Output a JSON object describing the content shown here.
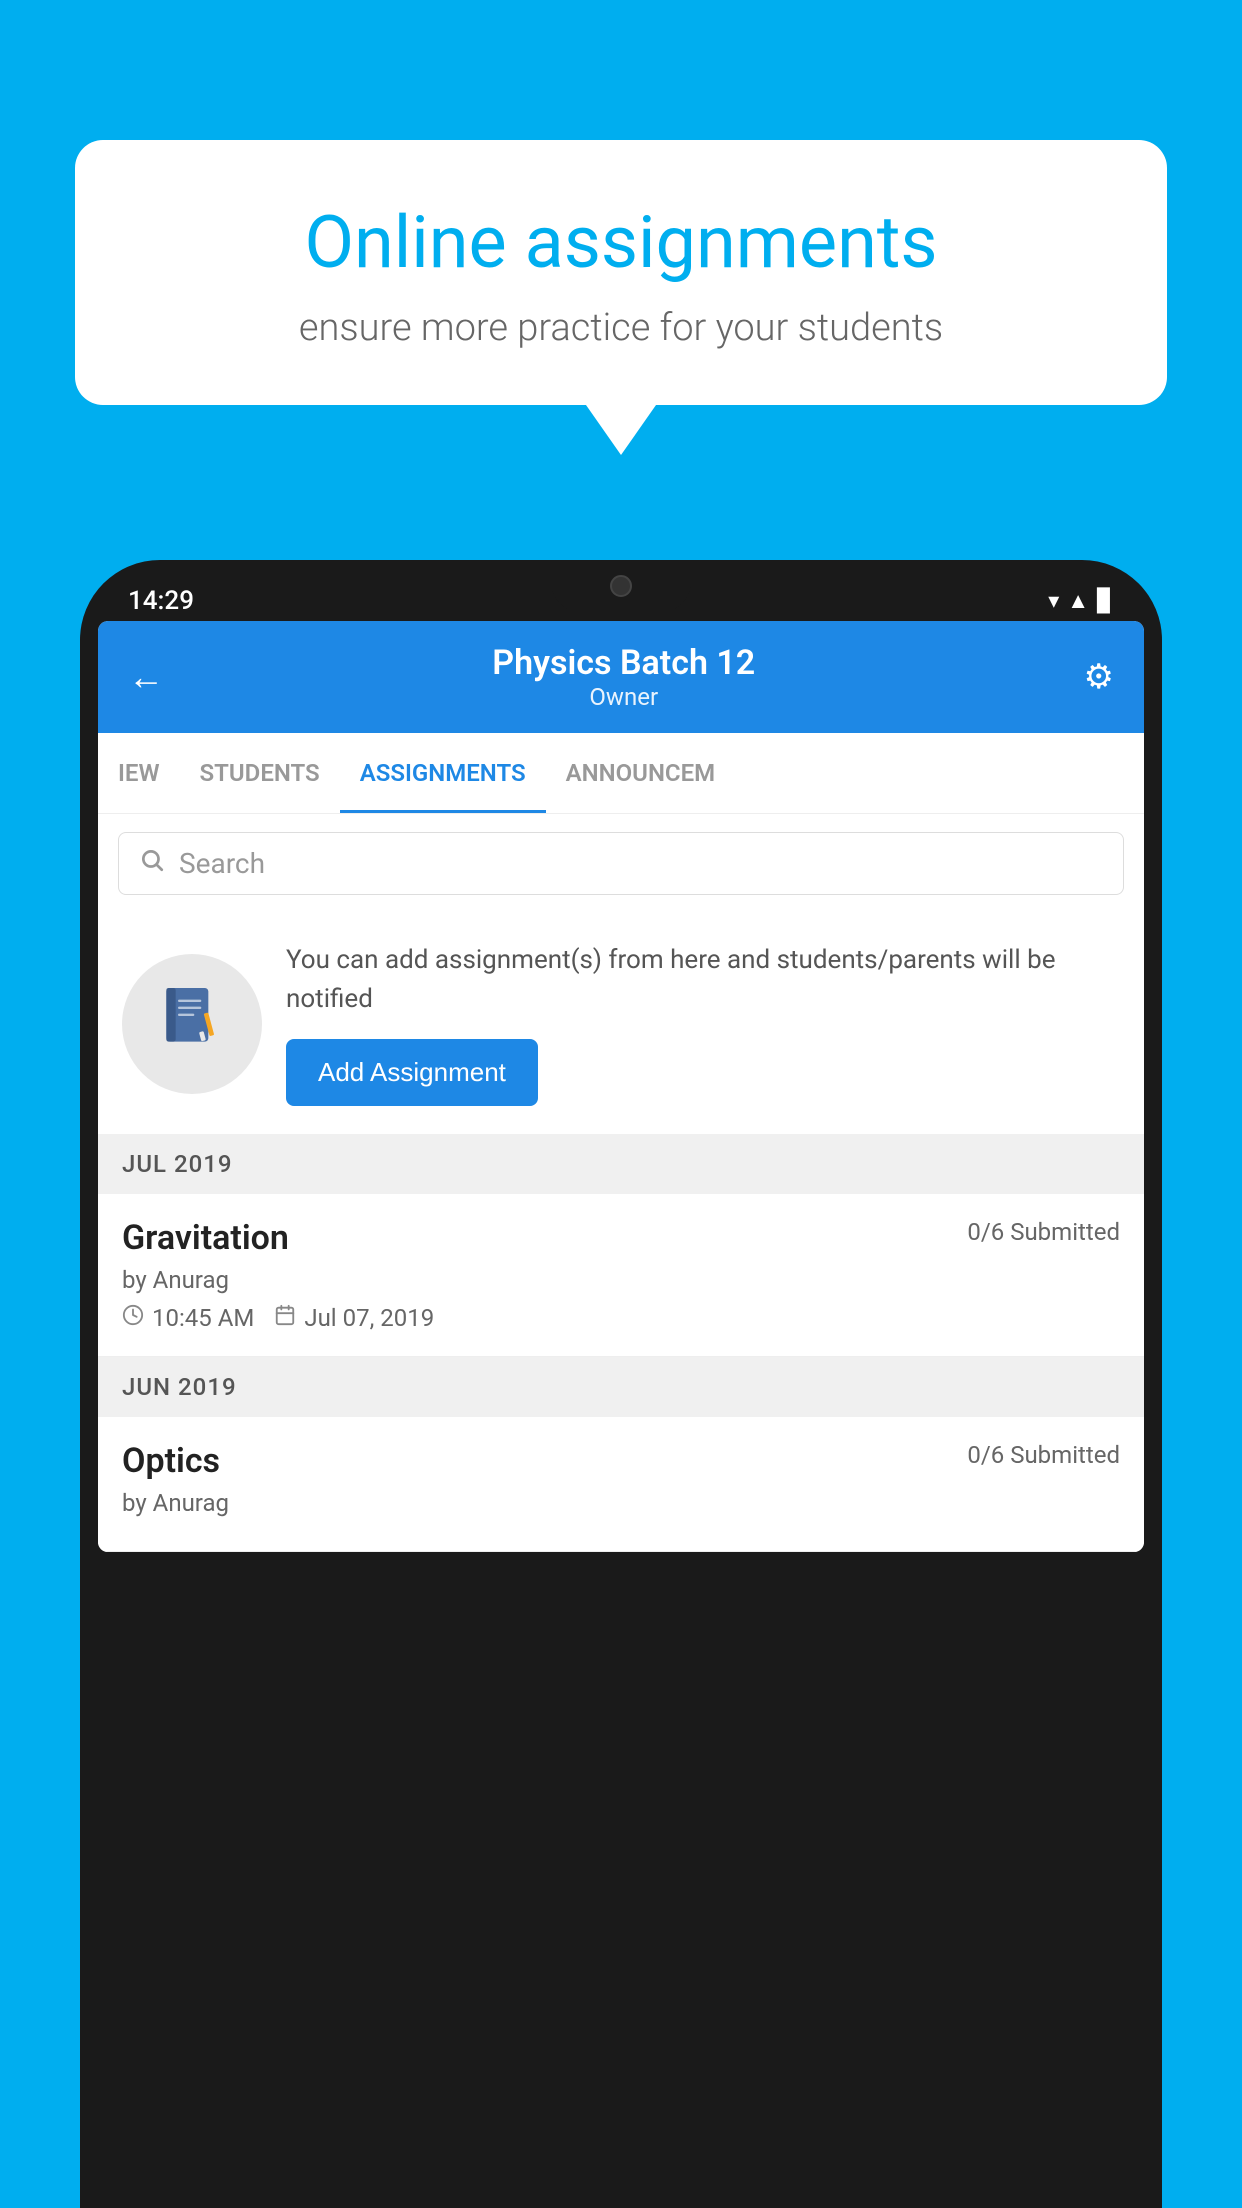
{
  "background_color": "#00AEEF",
  "speech_bubble": {
    "title": "Online assignments",
    "subtitle": "ensure more practice for your students"
  },
  "phone": {
    "status_bar": {
      "time": "14:29",
      "icons": [
        "wifi",
        "signal",
        "battery"
      ]
    },
    "app_bar": {
      "title": "Physics Batch 12",
      "subtitle": "Owner",
      "back_label": "←",
      "settings_label": "⚙"
    },
    "tabs": [
      {
        "label": "IEW",
        "active": false
      },
      {
        "label": "STUDENTS",
        "active": false
      },
      {
        "label": "ASSIGNMENTS",
        "active": true
      },
      {
        "label": "ANNOUNCEM",
        "active": false
      }
    ],
    "search": {
      "placeholder": "Search"
    },
    "info_card": {
      "text": "You can add assignment(s) from here and students/parents will be notified",
      "button_label": "Add Assignment"
    },
    "sections": [
      {
        "header": "JUL 2019",
        "assignments": [
          {
            "name": "Gravitation",
            "submitted": "0/6 Submitted",
            "author": "by Anurag",
            "time": "10:45 AM",
            "date": "Jul 07, 2019"
          }
        ]
      },
      {
        "header": "JUN 2019",
        "assignments": [
          {
            "name": "Optics",
            "submitted": "0/6 Submitted",
            "author": "by Anurag",
            "time": "",
            "date": ""
          }
        ]
      }
    ]
  }
}
